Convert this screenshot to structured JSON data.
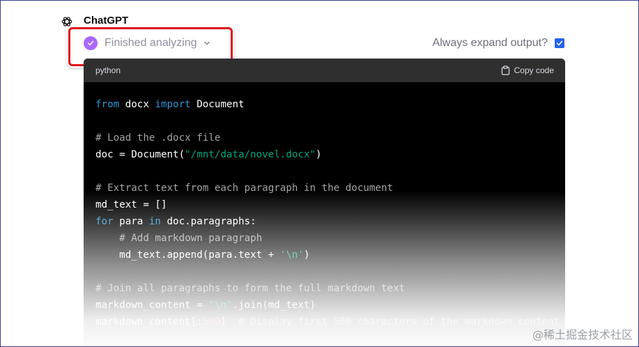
{
  "assistant": {
    "name": "ChatGPT"
  },
  "status": {
    "label": "Finished analyzing"
  },
  "expand_output": {
    "label": "Always expand output?",
    "checked": true
  },
  "code": {
    "language": "python",
    "copy_label": "Copy code",
    "lines": [
      [
        {
          "t": "from",
          "c": "kw"
        },
        {
          "t": " docx "
        },
        {
          "t": "import",
          "c": "kw"
        },
        {
          "t": " Document"
        }
      ],
      [],
      [
        {
          "t": "# Load the .docx file",
          "c": "cm"
        }
      ],
      [
        {
          "t": "doc = Document("
        },
        {
          "t": "\"/mnt/data/novel.docx\"",
          "c": "st"
        },
        {
          "t": ")"
        }
      ],
      [],
      [
        {
          "t": "# Extract text from each paragraph in the document",
          "c": "cm"
        }
      ],
      [
        {
          "t": "md_text = []"
        }
      ],
      [
        {
          "t": "for",
          "c": "kw"
        },
        {
          "t": " para "
        },
        {
          "t": "in",
          "c": "kw"
        },
        {
          "t": " doc.paragraphs:"
        }
      ],
      [
        {
          "t": "    "
        },
        {
          "t": "# Add markdown paragraph",
          "c": "cm"
        }
      ],
      [
        {
          "t": "    md_text.append(para.text + "
        },
        {
          "t": "'\\n'",
          "c": "st"
        },
        {
          "t": ")"
        }
      ],
      [],
      [
        {
          "t": "# Join all paragraphs to form the full markdown text",
          "c": "cm"
        }
      ],
      [
        {
          "t": "markdown_content = "
        },
        {
          "t": "\"\\n\"",
          "c": "st"
        },
        {
          "t": ".join(md_text)"
        }
      ],
      [
        {
          "t": "markdown_content[:"
        },
        {
          "t": "500",
          "c": "nm"
        },
        {
          "t": "]  "
        },
        {
          "t": "# Display first 500 characters of the markdown content",
          "c": "cm"
        }
      ]
    ]
  },
  "watermark": {
    "text": "@稀土掘金技术社区"
  },
  "colors": {
    "accent_purple": "#ab68ff",
    "checkbox_blue": "#2563eb",
    "highlight_red": "#e0141b"
  }
}
